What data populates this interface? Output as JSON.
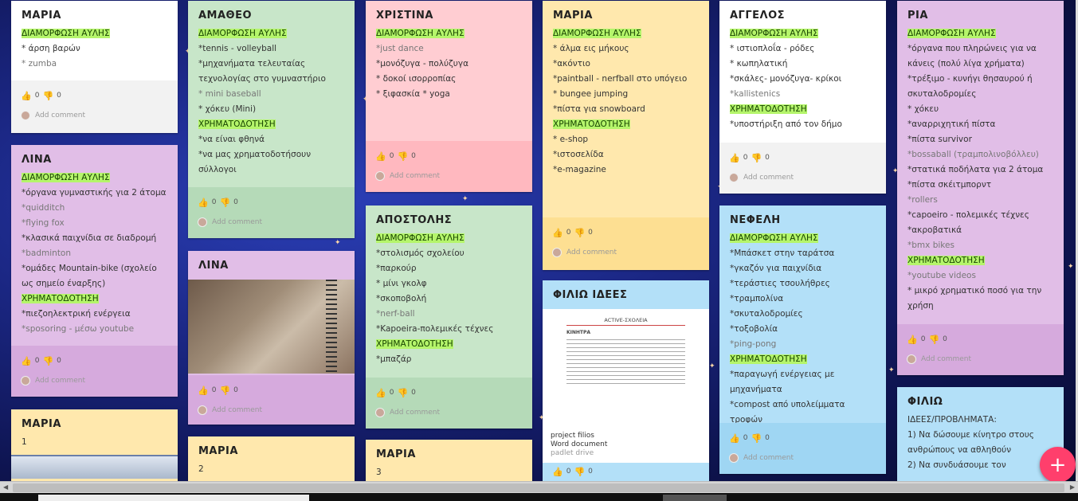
{
  "labels": {
    "add_comment": "Add comment",
    "votes_up": "0",
    "votes_down": "0"
  },
  "cards": {
    "maria1": {
      "title": "ΜΑΡΙΑ",
      "lines": [
        "ΔΙΑΜΟΡΦΩΣΗ ΑΥΛΗΣ",
        "* άρση βαρών",
        "*  zumba"
      ]
    },
    "lina1": {
      "title": "ΛΙΝΑ",
      "lines": [
        "ΔΙΑΜΟΡΦΩΣΗ ΑΥΛΗΣ",
        "*όργανα γυμναστικής για 2 άτομα",
        "*quidditch",
        "*flying fox",
        "*κλασικά παιχνίδια σε διαδρομή",
        "*badminton",
        "*ομάδες Mountain-bike (σχολείο ως σημείο έναρξης)",
        "ΧΡΗΜΑΤΟΔΟΤΗΣΗ",
        "*πιεζοηλεκτρική ενέργεια",
        "*sposoring - μέσω youtube"
      ]
    },
    "maria_1": {
      "title": "ΜΑΡΙΑ",
      "lines": [
        "1"
      ]
    },
    "amatheo": {
      "title": "ΑΜΑΘΕΟ",
      "lines": [
        "ΔΙΑΜΟΡΦΩΣΗ ΑΥΛΗΣ",
        "*tennis - volleyball",
        "*μηχανήματα τελευταίας τεχνολογίας στο γυμναστήριο",
        "* mini baseball",
        "* χόκευ (Mini)",
        "ΧΡΗΜΑΤΟΔΟΤΗΣΗ",
        "*να είναι φθηνά",
        "*να μας χρηματοδοτήσουν σύλλογοι"
      ]
    },
    "lina2": {
      "title": "ΛΙΝΑ"
    },
    "maria_2": {
      "title": "ΜΑΡΙΑ",
      "lines": [
        "2"
      ]
    },
    "christina": {
      "title": "ΧΡΙΣΤΙΝΑ",
      "lines": [
        "ΔΙΑΜΟΡΦΩΣΗ ΑΥΛΗΣ",
        "*just dance",
        "*μονόζυγα - πολύζυγα",
        "* δοκοί ισορροπίας",
        "* ξιφασκία * yoga"
      ]
    },
    "apostolis": {
      "title": "ΑΠΟΣΤΟΛΗΣ",
      "lines": [
        "ΔΙΑΜΟΡΦΩΣΗ ΑΥΛΗΣ",
        "*στολισμός σχολείου",
        "*παρκούρ",
        "* μίνι γκολφ",
        "*σκοποβολή",
        "*nerf-ball",
        "*Kapoeira-πολεμικές τέχνες",
        "ΧΡΗΜΑΤΟΔΟΤΗΣΗ",
        "*μπαζάρ"
      ]
    },
    "maria_3": {
      "title": "ΜΑΡΙΑ",
      "lines": [
        "3"
      ]
    },
    "maria2": {
      "title": "ΜΑΡΙΑ",
      "lines": [
        "ΔΙΑΜΟΡΦΩΣΗ ΑΥΛΗΣ",
        "* άλμα εις μήκους",
        "*ακόντιο",
        "*paintball - nerfball στο υπόγειο",
        "* bungee jumping",
        "*πίστα για snowboard",
        "ΧΡΗΜΑΤΟΔΟΤΗΣΗ",
        "* e-shop",
        "*ιστοσελίδα",
        "*e-magazine"
      ]
    },
    "filio_ideas": {
      "title": "ΦΙΛΙΩ ΙΔΕΕΣ",
      "doc_title": "ACTIVE-ΣΧΟΛΕΙΑ",
      "doc_heading": "ΚΙΝΗΤΡΑ",
      "doc_name": "project filios",
      "doc_type": "Word document",
      "doc_src": "padlet drive"
    },
    "angelos": {
      "title": "ΑΓΓΕΛΟΣ",
      "lines": [
        "ΔΙΑΜΟΡΦΩΣΗ ΑΥΛΗΣ",
        "* ιστιοπλοΐα - ρόδες",
        "* κωπηλατική",
        "*σκάλες- μονόζυγα- κρίκοι",
        "*kallistenics",
        "ΧΡΗΜΑΤΟΔΟΤΗΣΗ",
        "*υποστήριξη από τον δήμο"
      ]
    },
    "nefeli": {
      "title": "ΝΕΦΕΛΗ",
      "lines": [
        "ΔΙΑΜΟΡΦΩΣΗ ΑΥΛΗΣ",
        "*Μπάσκετ στην ταράτσα",
        "*γκαζόν για παιχνίδια",
        "*τεράστιες τσουλήθρες",
        "*τραμπολίνα",
        "*σκυταλοδρομίες",
        "*τοξοβολία",
        "*ping-pong",
        "ΧΡΗΜΑΤΟΔΟΤΗΣΗ",
        "*παραγωγή ενέργειας με μηχανήματα",
        "*compost από υπολείμματα τροφών"
      ]
    },
    "ria": {
      "title": "ΡΙΑ",
      "lines": [
        "ΔΙΑΜΟΡΦΩΣΗ ΑΥΛΗΣ",
        "*όργανα που πληρώνεις για να κάνεις (πολύ λίγα χρήματα)",
        "*τρέξιμο - κυνήγι θησαυρού ή σκυταλοδρομίες",
        "* χόκευ",
        "*αναρριχητική πίστα",
        "*πίστα survivor",
        "*bossaball (τραμπολινοβόλλευ)",
        "*στατικά ποδήλατα για 2 άτομα",
        "*πίστα σκέιτμπορντ",
        "*rollers",
        "*capoeiro - πολεμικές τέχνες",
        "*ακροβατικά",
        "*bmx bikes",
        "ΧΡΗΜΑΤΟΔΟΤΗΣΗ",
        "*youtube videos",
        "* μικρό χρηματικό ποσό για την χρήση"
      ]
    },
    "filio": {
      "title": "ΦΙΛΙΩ",
      "lines": [
        "ΙΔΕΕΣ/ΠΡΟΒΛΗΜΑΤΑ:",
        "1)      Να δώσουμε κίνητρο στους ανθρώπους να αθληθούν",
        "2)      Να συνδυάσουμε τον"
      ]
    }
  },
  "fab_label": "+",
  "colors": {
    "accent": "#ff3f6c",
    "highlight": "#b5f56b"
  }
}
